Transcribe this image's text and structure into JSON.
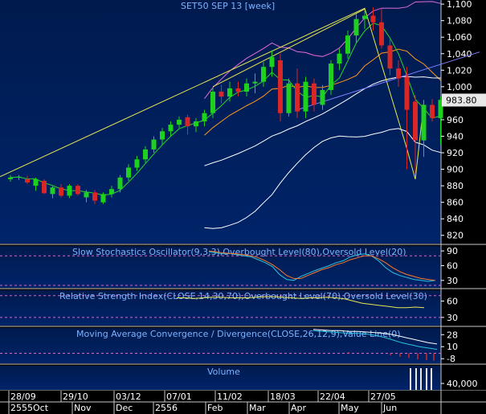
{
  "chart_data": [
    {
      "type": "candlestick",
      "title": "SET50 SEP 13 [week]",
      "ylim": [
        810,
        1105
      ],
      "yticks": [
        "1,100",
        "1,080",
        "1,060",
        "1,040",
        "1,020",
        "1,000",
        "980",
        "960",
        "940",
        "920",
        "900",
        "880",
        "860",
        "840",
        "820"
      ],
      "last_value": "983.80",
      "candles": [
        {
          "o": 888,
          "h": 893,
          "l": 885,
          "c": 890
        },
        {
          "o": 890,
          "h": 893,
          "l": 887,
          "c": 891
        },
        {
          "o": 888,
          "h": 892,
          "l": 882,
          "c": 884
        },
        {
          "o": 880,
          "h": 890,
          "l": 874,
          "c": 888
        },
        {
          "o": 886,
          "h": 888,
          "l": 870,
          "c": 871
        },
        {
          "o": 870,
          "h": 880,
          "l": 865,
          "c": 878
        },
        {
          "o": 878,
          "h": 882,
          "l": 866,
          "c": 868
        },
        {
          "o": 868,
          "h": 882,
          "l": 865,
          "c": 880
        },
        {
          "o": 880,
          "h": 882,
          "l": 868,
          "c": 870
        },
        {
          "o": 866,
          "h": 875,
          "l": 860,
          "c": 872
        },
        {
          "o": 872,
          "h": 875,
          "l": 858,
          "c": 862
        },
        {
          "o": 860,
          "h": 872,
          "l": 858,
          "c": 870
        },
        {
          "o": 870,
          "h": 880,
          "l": 866,
          "c": 876
        },
        {
          "o": 876,
          "h": 893,
          "l": 872,
          "c": 890
        },
        {
          "o": 890,
          "h": 906,
          "l": 886,
          "c": 902
        },
        {
          "o": 902,
          "h": 916,
          "l": 898,
          "c": 912
        },
        {
          "o": 912,
          "h": 928,
          "l": 908,
          "c": 924
        },
        {
          "o": 924,
          "h": 940,
          "l": 920,
          "c": 936
        },
        {
          "o": 936,
          "h": 950,
          "l": 930,
          "c": 946
        },
        {
          "o": 946,
          "h": 958,
          "l": 940,
          "c": 954
        },
        {
          "o": 954,
          "h": 964,
          "l": 950,
          "c": 960
        },
        {
          "o": 963,
          "h": 966,
          "l": 942,
          "c": 952
        },
        {
          "o": 952,
          "h": 962,
          "l": 945,
          "c": 958
        },
        {
          "o": 958,
          "h": 972,
          "l": 952,
          "c": 968
        },
        {
          "o": 968,
          "h": 998,
          "l": 962,
          "c": 994
        },
        {
          "o": 994,
          "h": 1002,
          "l": 980,
          "c": 988
        },
        {
          "o": 988,
          "h": 1006,
          "l": 982,
          "c": 998
        },
        {
          "o": 998,
          "h": 1006,
          "l": 988,
          "c": 994
        },
        {
          "o": 994,
          "h": 1010,
          "l": 988,
          "c": 1004
        },
        {
          "o": 1004,
          "h": 1016,
          "l": 992,
          "c": 1006
        },
        {
          "o": 1006,
          "h": 1030,
          "l": 1000,
          "c": 1024
        },
        {
          "o": 1024,
          "h": 1044,
          "l": 1012,
          "c": 1036
        },
        {
          "o": 1032,
          "h": 1040,
          "l": 958,
          "c": 968
        },
        {
          "o": 968,
          "h": 1010,
          "l": 964,
          "c": 1004
        },
        {
          "o": 1004,
          "h": 1022,
          "l": 962,
          "c": 970
        },
        {
          "o": 970,
          "h": 1012,
          "l": 962,
          "c": 1006
        },
        {
          "o": 1004,
          "h": 1010,
          "l": 970,
          "c": 978
        },
        {
          "o": 978,
          "h": 1002,
          "l": 972,
          "c": 996
        },
        {
          "o": 996,
          "h": 1032,
          "l": 990,
          "c": 1028
        },
        {
          "o": 1028,
          "h": 1046,
          "l": 1020,
          "c": 1040
        },
        {
          "o": 1040,
          "h": 1068,
          "l": 1034,
          "c": 1062
        },
        {
          "o": 1062,
          "h": 1088,
          "l": 1052,
          "c": 1082
        },
        {
          "o": 1082,
          "h": 1092,
          "l": 1070,
          "c": 1086
        },
        {
          "o": 1086,
          "h": 1096,
          "l": 1068,
          "c": 1078
        },
        {
          "o": 1078,
          "h": 1094,
          "l": 1046,
          "c": 1050
        },
        {
          "o": 1050,
          "h": 1058,
          "l": 1014,
          "c": 1022
        },
        {
          "o": 1022,
          "h": 1032,
          "l": 1000,
          "c": 1010
        },
        {
          "o": 1012,
          "h": 1024,
          "l": 900,
          "c": 972
        },
        {
          "o": 982,
          "h": 990,
          "l": 895,
          "c": 935
        },
        {
          "o": 935,
          "h": 984,
          "l": 915,
          "c": 978
        },
        {
          "o": 978,
          "h": 985,
          "l": 958,
          "c": 962
        },
        {
          "o": 962,
          "h": 988,
          "l": 930,
          "c": 984
        }
      ]
    },
    {
      "type": "line",
      "title": "Slow Stochastics Oscillator(9,3,3),Overbought Level(80),Oversold Level(20)",
      "yticks": [
        "90",
        "60",
        "30"
      ],
      "ylim": [
        15,
        100
      ]
    },
    {
      "type": "line",
      "title": "Relative Strength Index(CLOSE,14,30,70),Overbought Level(70),Oversold Level(30)",
      "yticks": [
        "60",
        "30"
      ],
      "ylim": [
        15,
        80
      ]
    },
    {
      "type": "line",
      "title": "Moving Average Convergence / Divergence(CLOSE,26,12,9),Value Line(0)",
      "yticks": [
        "28",
        "10",
        "-8"
      ],
      "ylim": [
        -15,
        38
      ]
    },
    {
      "type": "bar",
      "title": "Volume",
      "yticks": [
        "40,000"
      ]
    }
  ],
  "xaxis": {
    "dates": [
      "28/09",
      "29/10",
      "03/12",
      "07/01",
      "11/02",
      "18/03",
      "22/04",
      "27/05"
    ],
    "months": [
      "2555Oct",
      "Nov",
      "Dec",
      "2556",
      "Feb",
      "Mar",
      "Apr",
      "May",
      "Jun"
    ]
  }
}
